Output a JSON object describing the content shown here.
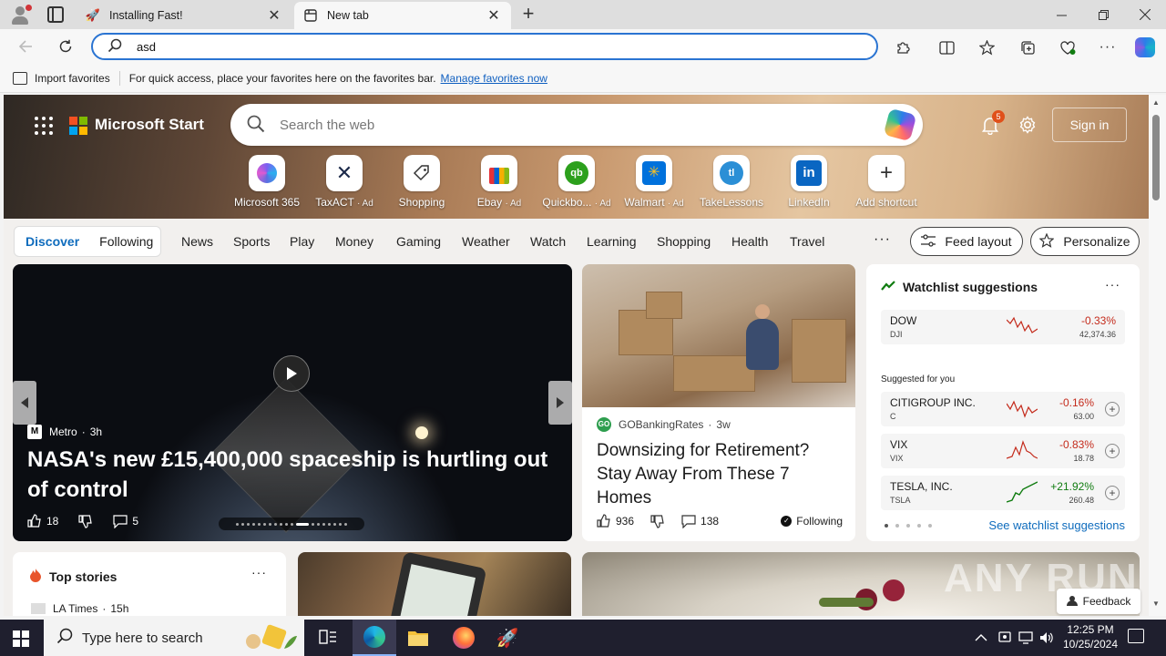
{
  "tabs": [
    {
      "label": "Installing Fast!",
      "icon": "rocket-icon"
    },
    {
      "label": "New tab",
      "icon": "new-tab-icon"
    }
  ],
  "address": {
    "value": "asd"
  },
  "favorites_bar": {
    "import_label": "Import favorites",
    "hint": "For quick access, place your favorites here on the favorites bar.",
    "manage_link": "Manage favorites now"
  },
  "header": {
    "brand": "Microsoft Start",
    "search_placeholder": "Search the web",
    "notification_count": "5",
    "signin_label": "Sign in"
  },
  "shortcuts": [
    {
      "label": "Microsoft 365",
      "ad": "",
      "icon": "microsoft365-icon",
      "color": "#5b6ee1"
    },
    {
      "label": "TaxACT",
      "ad": "· Ad",
      "icon": "taxact-icon",
      "color": "#1c2a4a"
    },
    {
      "label": "Shopping",
      "ad": "",
      "icon": "shopping-tag-icon",
      "color": "#333333"
    },
    {
      "label": "Ebay",
      "ad": "· Ad",
      "icon": "ebay-icon",
      "color": "#e53238"
    },
    {
      "label": "Quickbo...",
      "ad": "· Ad",
      "icon": "quickbooks-icon",
      "color": "#2ca01c"
    },
    {
      "label": "Walmart",
      "ad": "· Ad",
      "icon": "walmart-icon",
      "color": "#0071dc"
    },
    {
      "label": "TakeLessons",
      "ad": "",
      "icon": "takelessons-icon",
      "color": "#2b8fd6"
    },
    {
      "label": "LinkedIn",
      "ad": "",
      "icon": "linkedin-icon",
      "color": "#0a66c2"
    },
    {
      "label": "Add shortcut",
      "ad": "",
      "icon": "plus-icon",
      "color": "#333333"
    }
  ],
  "feed_nav": {
    "discover": "Discover",
    "following": "Following",
    "items": [
      "News",
      "Sports",
      "Play",
      "Money",
      "Gaming",
      "Weather",
      "Watch",
      "Learning",
      "Shopping",
      "Health",
      "Travel"
    ],
    "more": "···",
    "feed_layout": "Feed layout",
    "personalize": "Personalize"
  },
  "main_story": {
    "source": "Metro",
    "age": "3h",
    "headline": "NASA's new £15,400,000 spaceship is hurtling out of control",
    "likes": "18",
    "comments": "5"
  },
  "story2": {
    "source": "GOBankingRates",
    "age": "3w",
    "headline": "Downsizing for Retirement? Stay Away From These 7 Homes",
    "likes": "936",
    "comments": "138",
    "following": "Following"
  },
  "watchlist": {
    "title": "Watchlist suggestions",
    "suggested_label": "Suggested for you",
    "see_all": "See watchlist suggestions",
    "dow": {
      "name": "DOW",
      "symbol": "DJI",
      "change": "-0.33%",
      "price": "42,374.36"
    },
    "stocks": [
      {
        "name": "CITIGROUP INC.",
        "symbol": "C",
        "change": "-0.16%",
        "price": "63.00",
        "trend": "neg"
      },
      {
        "name": "VIX",
        "symbol": "VIX",
        "change": "-0.83%",
        "price": "18.78",
        "trend": "neg"
      },
      {
        "name": "TESLA, INC.",
        "symbol": "TSLA",
        "change": "+21.92%",
        "price": "260.48",
        "trend": "pos"
      }
    ]
  },
  "top_stories": {
    "title": "Top stories",
    "source": "LA Times",
    "age": "15h"
  },
  "feedback_label": "Feedback",
  "watermark": "ANY RUN",
  "taskbar": {
    "search_placeholder": "Type here to search",
    "time": "12:25 PM",
    "date": "10/25/2024"
  },
  "colors": {
    "accent": "#0f6cbd",
    "negative": "#c42b1c",
    "positive": "#107c10",
    "address_border": "#2a74d2"
  }
}
